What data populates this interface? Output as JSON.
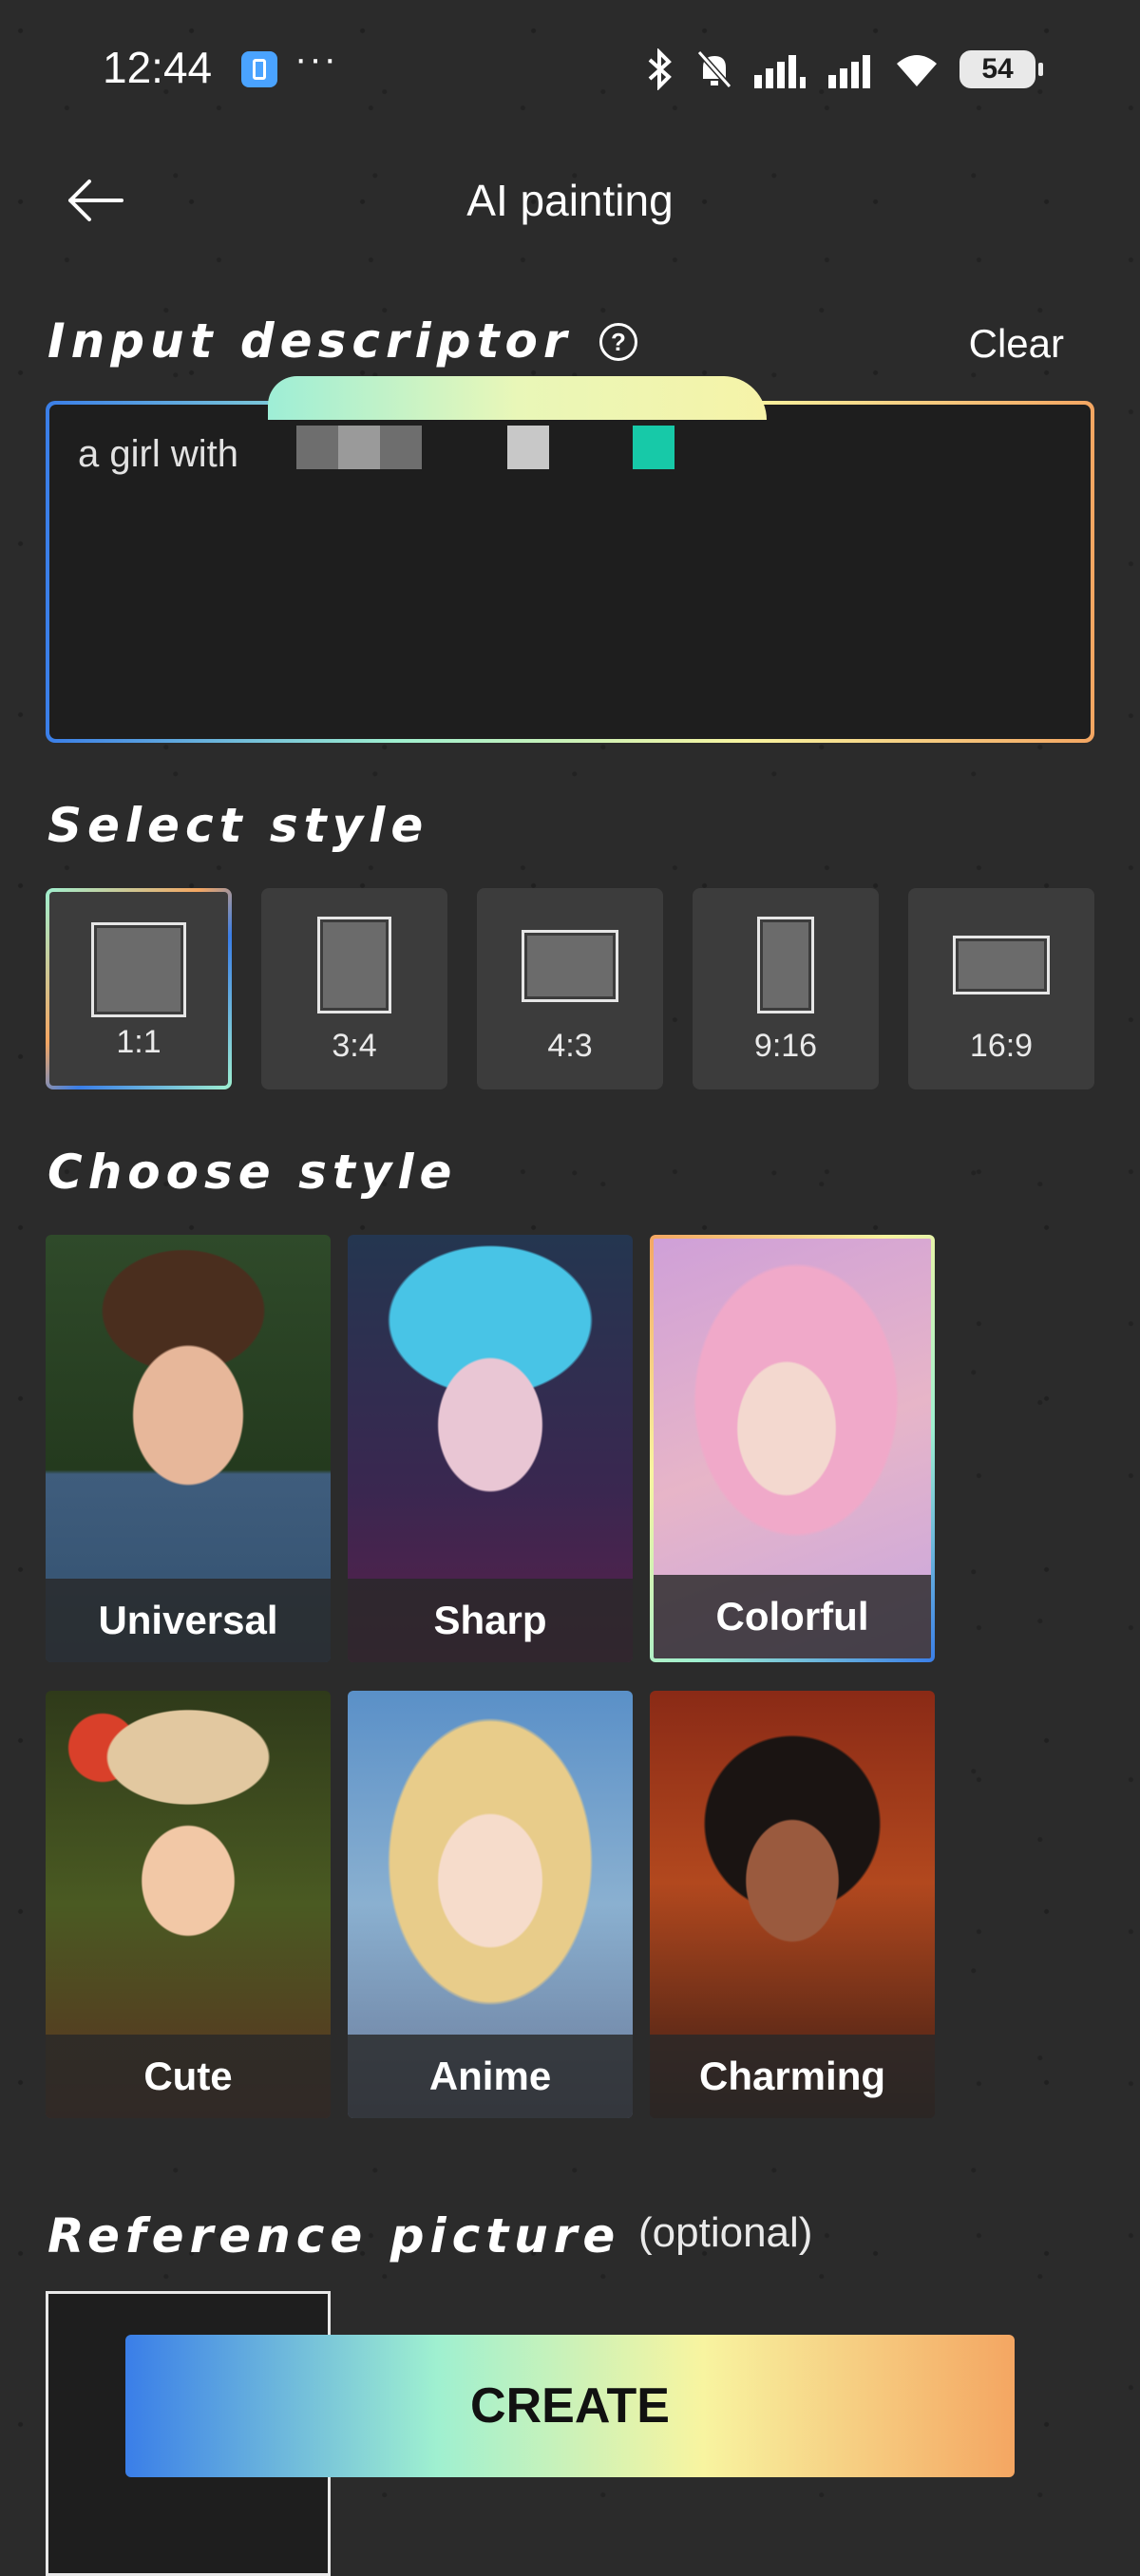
{
  "status_bar": {
    "time": "12:44",
    "dots": "···",
    "battery": "54",
    "icons": [
      "notification-app-icon",
      "bluetooth-icon",
      "mute-bell-icon",
      "signal-icon",
      "signal-icon",
      "wifi-icon",
      "battery-icon"
    ]
  },
  "header": {
    "title": "AI painting",
    "back_icon": "arrow-left-icon"
  },
  "input_section": {
    "title": "Input descriptor",
    "help_symbol": "?",
    "clear_label": "Clear",
    "text": "a girl with"
  },
  "select_style": {
    "title": "Select style",
    "options": [
      {
        "label": "1:1",
        "selected": true
      },
      {
        "label": "3:4",
        "selected": false
      },
      {
        "label": "4:3",
        "selected": false
      },
      {
        "label": "9:16",
        "selected": false
      },
      {
        "label": "16:9",
        "selected": false
      }
    ]
  },
  "choose_style": {
    "title": "Choose style",
    "styles": [
      {
        "label": "Universal",
        "selected": false
      },
      {
        "label": "Sharp",
        "selected": false
      },
      {
        "label": "Colorful",
        "selected": true
      },
      {
        "label": "Cute",
        "selected": false
      },
      {
        "label": "Anime",
        "selected": false
      },
      {
        "label": "Charming",
        "selected": false
      }
    ]
  },
  "reference": {
    "title": "Reference picture",
    "optional": "(optional)"
  },
  "create_button": {
    "label": "CREATE"
  },
  "colors": {
    "gradient": [
      "#3a7ee8",
      "#9ff0d0",
      "#f8f4a0",
      "#f4a662"
    ],
    "background": "#2b2b2b"
  }
}
